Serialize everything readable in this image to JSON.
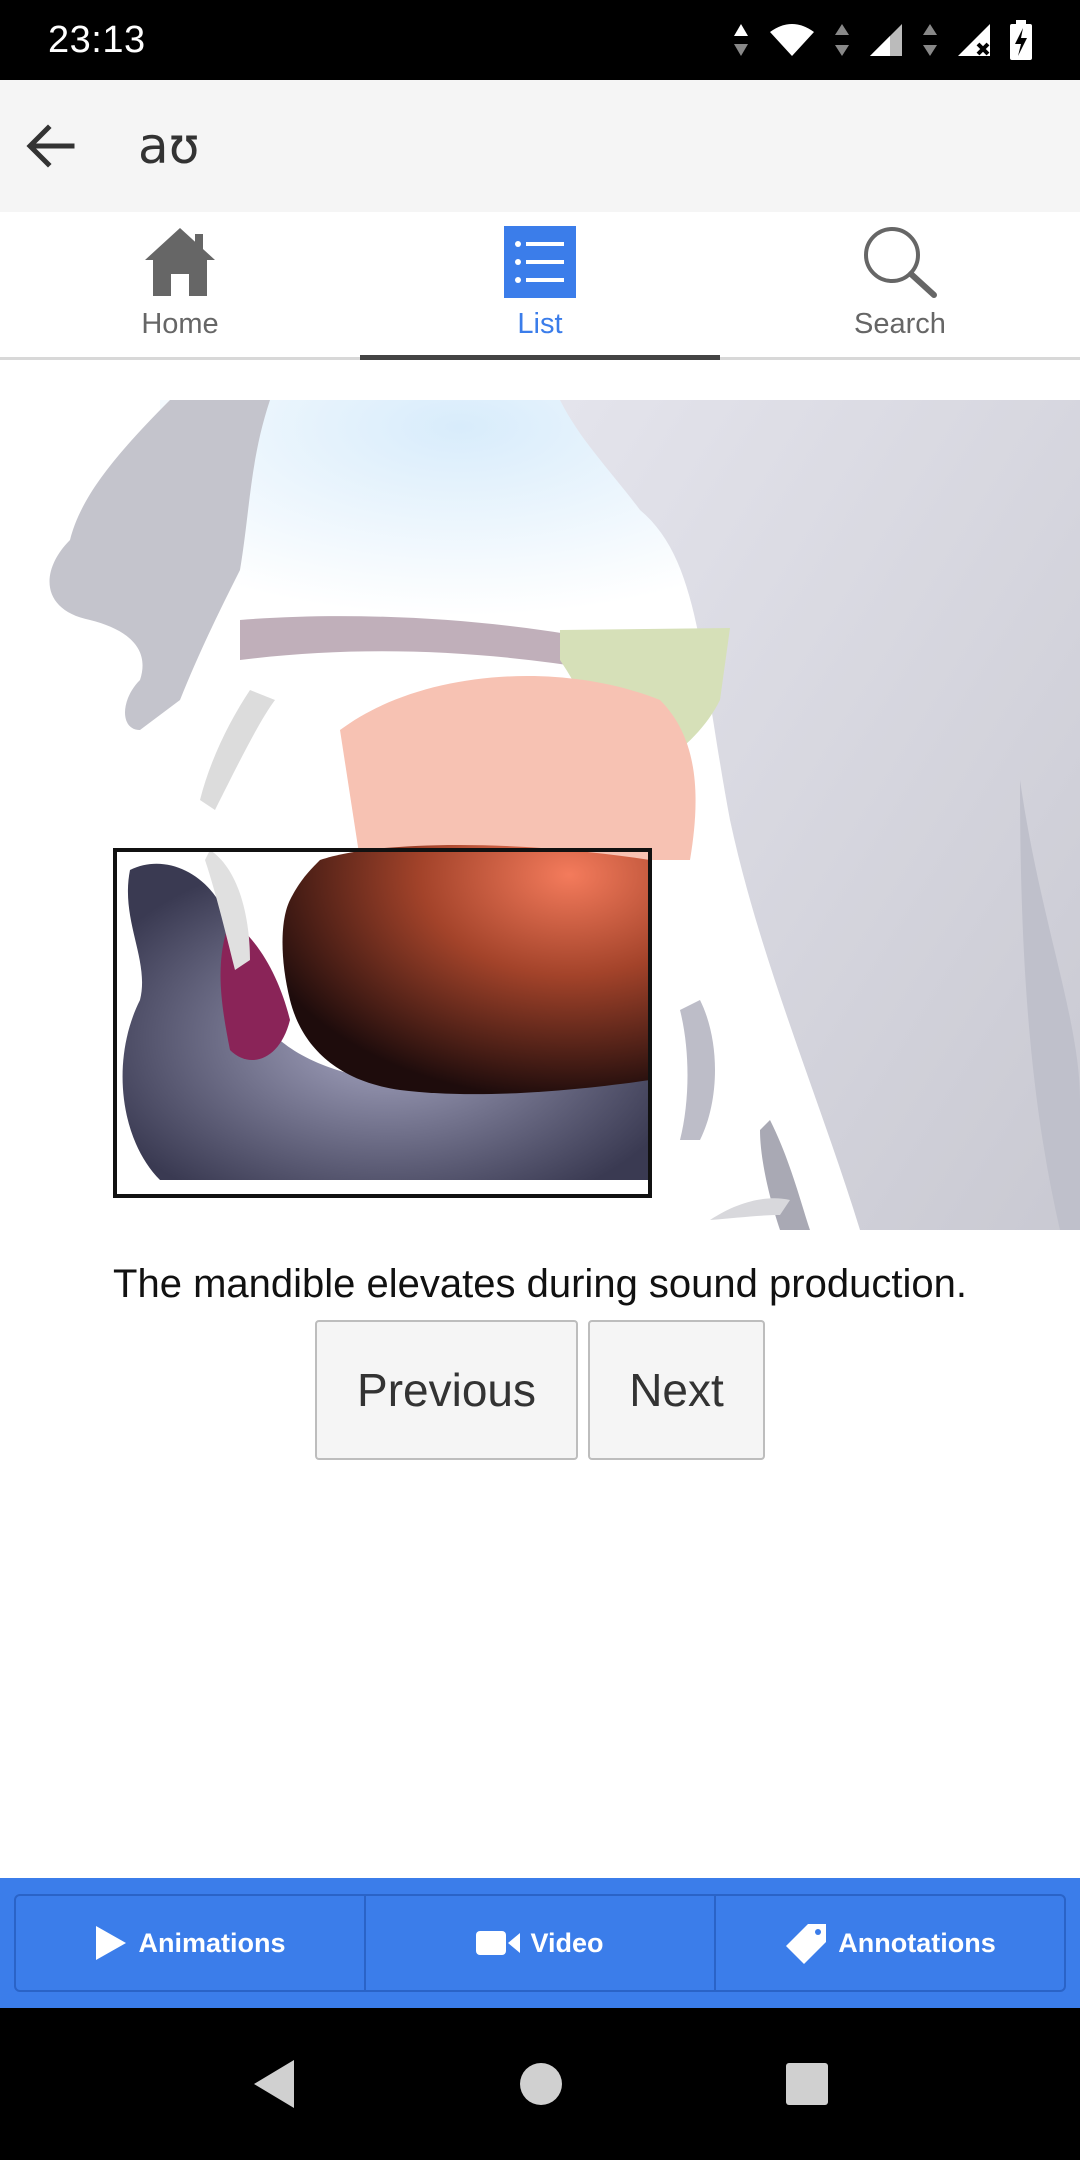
{
  "status_bar": {
    "time": "23:13"
  },
  "app_bar": {
    "title": "aʊ"
  },
  "tabs": [
    {
      "label": "Home",
      "icon": "home-icon",
      "active": false
    },
    {
      "label": "List",
      "icon": "list-icon",
      "active": true
    },
    {
      "label": "Search",
      "icon": "search-icon",
      "active": false
    }
  ],
  "figure": {
    "caption": "The mandible elevates during sound production."
  },
  "navigation": {
    "previous_label": "Previous",
    "next_label": "Next"
  },
  "bottom_toolbar": {
    "animations_label": "Animations",
    "video_label": "Video",
    "annotations_label": "Annotations"
  },
  "colors": {
    "accent": "#3b7dea",
    "status_bar": "#000000",
    "app_bar": "#f5f5f5"
  }
}
